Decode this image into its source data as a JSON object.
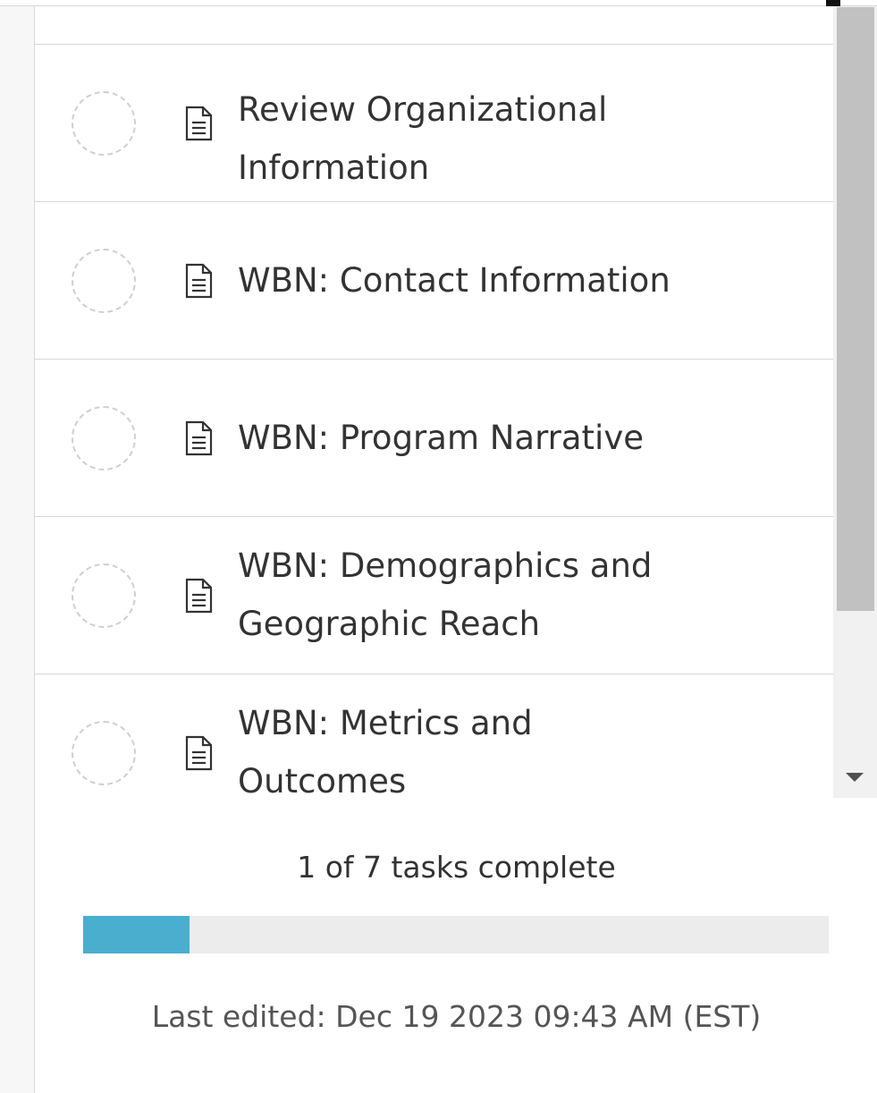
{
  "tasks": [
    {
      "label": "Review Organizational Information",
      "icon": "document-icon",
      "status": "incomplete"
    },
    {
      "label": "WBN: Contact Information",
      "icon": "document-icon",
      "status": "incomplete"
    },
    {
      "label": "WBN: Program Narrative",
      "icon": "document-icon",
      "status": "incomplete"
    },
    {
      "label": "WBN: Demographics and Geographic Reach",
      "icon": "document-icon",
      "status": "incomplete"
    },
    {
      "label": "WBN: Metrics and Outcomes",
      "icon": "document-icon",
      "status": "incomplete"
    }
  ],
  "progress": {
    "text": "1 of 7 tasks complete",
    "completed": 1,
    "total": 7,
    "fill_color": "#4aaecf",
    "track_color": "#ececec"
  },
  "footer": {
    "last_edited": "Last edited: Dec 19 2023 09:43 AM (EST)"
  }
}
